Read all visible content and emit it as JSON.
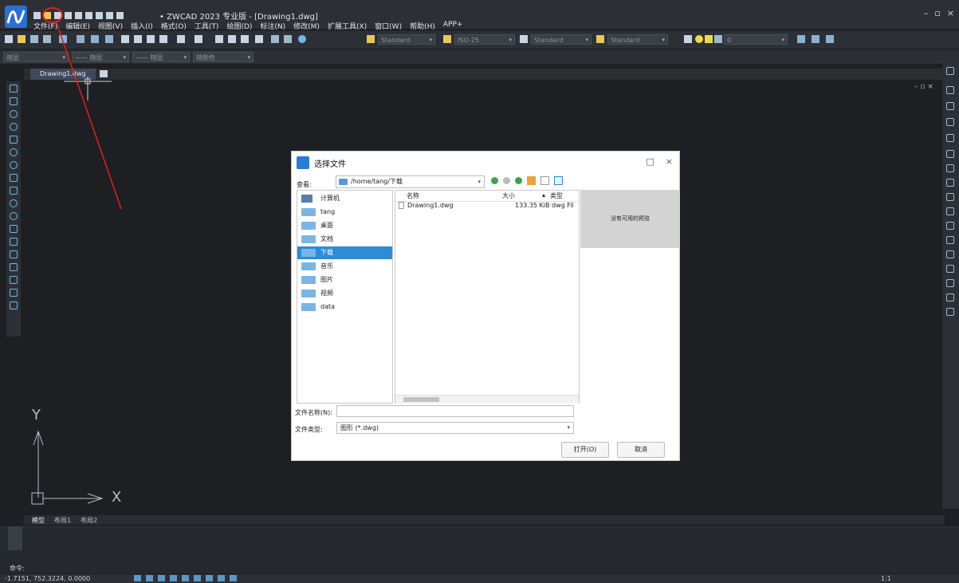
{
  "app": {
    "title": "• ZWCAD 2023 专业版 - [Drawing1.dwg]",
    "window_controls": [
      "–",
      "▫",
      "×"
    ],
    "menu": [
      "文件(F)",
      "编辑(E)",
      "视图(V)",
      "插入(I)",
      "格式(O)",
      "工具(T)",
      "绘图(D)",
      "标注(N)",
      "修改(M)",
      "扩展工具(X)",
      "窗口(W)",
      "帮助(H)",
      "APP+"
    ]
  },
  "toolbar": {
    "text_style": "Standard",
    "dim_style": "ISO-25",
    "table_style": "Standard",
    "mleader_style": "Standard",
    "layer": "0"
  },
  "properties": {
    "color": "随层",
    "linetype": "—— 随层",
    "lineweight": "—— 随层",
    "plotstyle": "随颜色"
  },
  "doc_tab": {
    "label": "Drawing1.dwg"
  },
  "doc_controls": "– ▫ ×",
  "ucs": {
    "x": "X",
    "y": "Y"
  },
  "layout_tabs": [
    "模型",
    "布局1",
    "布局2"
  ],
  "command": {
    "prompt": "命令:"
  },
  "status": {
    "coords": "-1.7151, 752.3224, 0.0000",
    "scale": "1:1"
  },
  "dialog": {
    "title": "选择文件",
    "controls": [
      "□",
      "×"
    ],
    "look_in_label": "查看:",
    "path": "/home/tang/下载",
    "places": [
      {
        "label": "计算机",
        "selected": false
      },
      {
        "label": "tang",
        "selected": false
      },
      {
        "label": "桌面",
        "selected": false
      },
      {
        "label": "文档",
        "selected": false
      },
      {
        "label": "下载",
        "selected": true
      },
      {
        "label": "音乐",
        "selected": false
      },
      {
        "label": "图片",
        "selected": false
      },
      {
        "label": "视频",
        "selected": false
      },
      {
        "label": "data",
        "selected": false
      }
    ],
    "columns": {
      "name": "名称",
      "size": "大小",
      "type": "类型"
    },
    "files": [
      {
        "name": "Drawing1.dwg",
        "size": "133.35 KiB",
        "type": "dwg Fil"
      }
    ],
    "preview_text": "没有可用的预览",
    "filename_label": "文件名称(N):",
    "filename_value": "",
    "filetype_label": "文件类型:",
    "filetype_value": "图形 (*.dwg)",
    "open_button": "打开(O)",
    "cancel_button": "取消"
  },
  "colors": {
    "accent": "#2f8bd6",
    "annotation": "#e0201b",
    "canvas": "#1d1f22",
    "chrome": "#2c3036"
  }
}
